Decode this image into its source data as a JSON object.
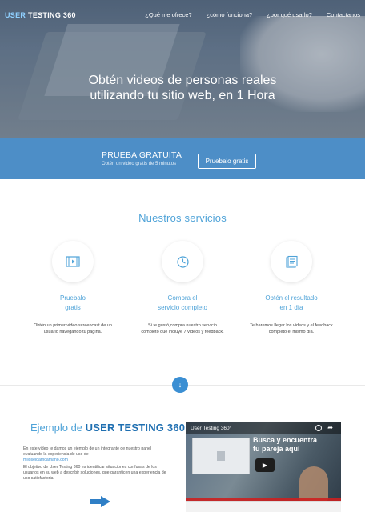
{
  "nav": {
    "logo_prefix": "USER",
    "logo_suffix": " TESTING 360",
    "links": [
      "¿Qué me ofrece?",
      "¿cómo funciona?",
      "¿por qué usarlo?",
      "Contactanos"
    ]
  },
  "hero": {
    "title_line1": "Obtén videos de personas reales",
    "title_line2": "utilizando tu sitio web, en 1 Hora"
  },
  "cta": {
    "title": "PRUEBA GRATUITA",
    "subtitle": "Obtén un video gratis de 5 minutos",
    "button": "Pruebalo gratis"
  },
  "services": {
    "title": "Nuestros servicios",
    "items": [
      {
        "name_line1": "Pruebalo",
        "name_line2": "gratis",
        "desc_line1": "Obtén un primer video screencast de un",
        "desc_line2": "usuario navegando tu página.",
        "icon": "video-icon"
      },
      {
        "name_line1": "Compra el",
        "name_line2": "servicio completo",
        "desc_line1": "Si te gustó,compra nuestro servicio",
        "desc_line2": "completo que incluye 7 videos y feedback.",
        "icon": "clock-icon"
      },
      {
        "name_line1": "Obtén el resultado",
        "name_line2": "en 1 día",
        "desc_line1": "Te haremos llegar los videos y el feedback",
        "desc_line2": "completo el mismo día.",
        "icon": "document-icon"
      }
    ]
  },
  "example": {
    "title_prefix": "Ejemplo de ",
    "title_brand": "USER TESTING 360",
    "para1": "En este video te damos un ejemplo de un integrante de nuestro panel evaluando la experiencia de uso de",
    "para1_link": "miloseldamcamano.com",
    "para2": "El objetivo de User Testing 360 es identificar situaciones confusas de los usuarios en su web a describir soluciones, que garanticen una experiencia de uso satisfactoria."
  },
  "video": {
    "title": "User Testing 360°",
    "overlay_line1": "Busca y encuentra",
    "overlay_line2": "tu pareja aquí"
  },
  "colors": {
    "accent": "#4fa3d8",
    "cta_band": "#4d8ec7",
    "brand_dark": "#1f6fb1"
  }
}
